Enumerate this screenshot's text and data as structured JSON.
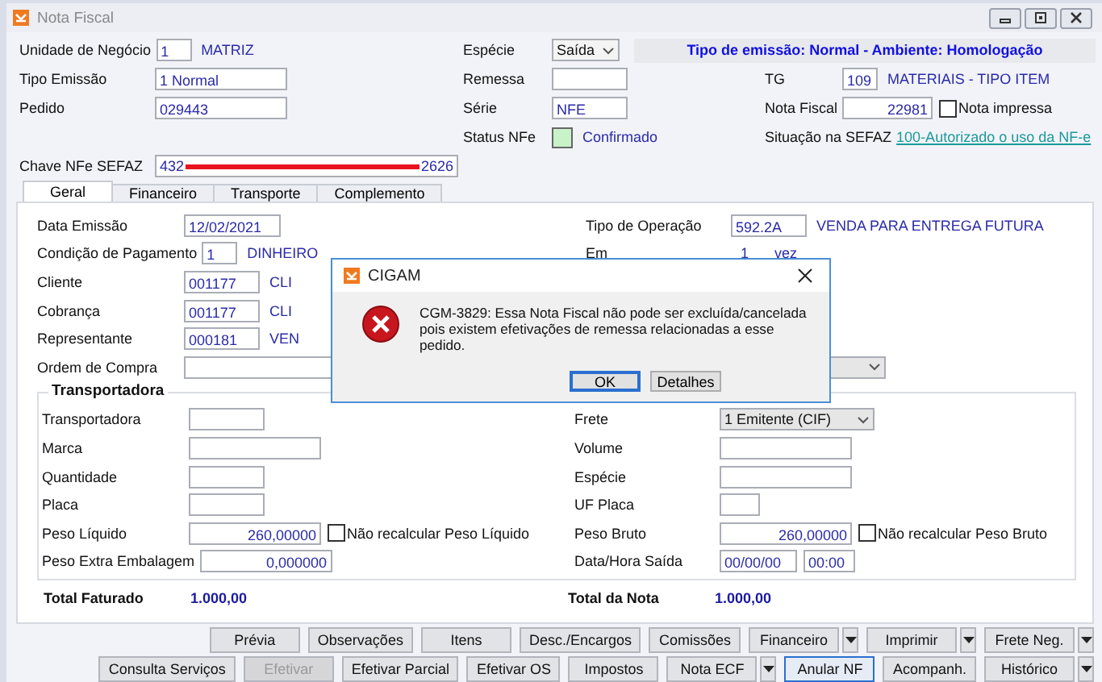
{
  "window": {
    "title": "Nota Fiscal"
  },
  "header": {
    "rows": [
      {
        "left": {
          "label": "Unidade de Negócio",
          "kind": "code",
          "value": "1",
          "description": "MATRIZ"
        },
        "middle": {
          "label": "Espécie",
          "kind": "select",
          "value": "Saída"
        },
        "banner": "Tipo de emissão: Normal - Ambiente: Homologação"
      },
      {
        "left": {
          "label": "Tipo Emissão",
          "kind": "text",
          "value": "1 Normal"
        },
        "middle": {
          "label": "Remessa",
          "kind": "short"
        },
        "right": {
          "label": "TG",
          "kind": "code",
          "value": "109",
          "description": "MATERIAIS - TIPO ITEM"
        }
      },
      {
        "left": {
          "label": "Pedido",
          "kind": "text",
          "value": "029443"
        },
        "middle": {
          "label": "Série",
          "kind": "short",
          "value": "NFE"
        },
        "right": {
          "label": "Nota Fiscal",
          "kind": "doc-number",
          "value": "22981",
          "checkbox": {
            "label": "Nota impressa",
            "checked": false
          }
        }
      },
      {
        "middle": {
          "label": "Status NFe",
          "kind": "status",
          "value": "Confirmado"
        },
        "right": {
          "label": "Situação na SEFAZ",
          "kind": "link",
          "value": "100-Autorizado o uso da NF-e"
        }
      },
      {
        "left": {
          "label": "Chave NFe SEFAZ",
          "kind": "redacted",
          "value_start": "432",
          "value_end": "2626"
        }
      }
    ]
  },
  "tabs": [
    {
      "label": "Geral",
      "selected": true
    },
    {
      "label": "Financeiro",
      "selected": false
    },
    {
      "label": "Transporte",
      "selected": false
    },
    {
      "label": "Complemento",
      "selected": false
    }
  ],
  "geral": {
    "rows": [
      {
        "left": {
          "label": "Data Emissão",
          "kind": "date",
          "value": "12/02/2021"
        },
        "right": {
          "label": "Tipo de Operação",
          "kind": "short",
          "value": "592.2A",
          "description": "VENDA PARA ENTREGA FUTURA"
        }
      },
      {
        "left": {
          "label": "Condição de Pagamento",
          "kind": "code",
          "value": "1",
          "description": "DINHEIRO"
        },
        "right": {
          "label": "Em",
          "kind": "plain",
          "value": "1",
          "unit": "vez"
        }
      },
      {
        "left": {
          "label": "Cliente",
          "kind": "short",
          "value": "001177",
          "description": "CLI"
        }
      },
      {
        "left": {
          "label": "Cobrança",
          "kind": "short",
          "value": "001177",
          "description": "CLI"
        }
      },
      {
        "left": {
          "label": "Representante",
          "kind": "short",
          "value": "000181",
          "description": "VEN"
        }
      },
      {
        "left": {
          "label": "Ordem de Compra",
          "kind": "wide"
        },
        "right": {
          "kind": "select"
        }
      }
    ]
  },
  "transportadora": {
    "title": "Transportadora",
    "rows": [
      {
        "left": {
          "label": "Transportadora",
          "kind": "short"
        },
        "right": {
          "label": "Frete",
          "kind": "select",
          "value": "1 Emitente (CIF)"
        }
      },
      {
        "left": {
          "label": "Marca",
          "kind": "text"
        },
        "right": {
          "label": "Volume",
          "kind": "text"
        }
      },
      {
        "left": {
          "label": "Quantidade",
          "kind": "short"
        },
        "right": {
          "label": "Espécie",
          "kind": "text"
        }
      },
      {
        "left": {
          "label": "Placa",
          "kind": "short"
        },
        "right": {
          "label": "UF Placa",
          "kind": "tiny"
        }
      },
      {
        "left": {
          "label": "Peso Líquido",
          "kind": "number",
          "value": "260,00000",
          "checkbox": {
            "label": "Não recalcular Peso Líquido",
            "checked": false
          }
        },
        "right": {
          "label": "Peso Bruto",
          "kind": "number",
          "value": "260,00000",
          "checkbox": {
            "label": "Não recalcular Peso Bruto",
            "checked": false
          }
        }
      },
      {
        "left": {
          "label": "Peso Extra Embalagem",
          "kind": "number",
          "value": "0,000000"
        },
        "right": {
          "label": "Data/Hora Saída",
          "kind": "datetime",
          "date": "00/00/00",
          "time": "00:00"
        }
      }
    ]
  },
  "totals": [
    {
      "label": "Total Faturado",
      "value": "1.000,00"
    },
    {
      "label": "Total da Nota",
      "value": "1.000,00"
    }
  ],
  "button_rows": [
    [
      {
        "label": "Prévia"
      },
      {
        "label": "Observações"
      },
      {
        "label": "Itens"
      },
      {
        "label": "Desc./Encargos"
      },
      {
        "label": "Comissões"
      },
      {
        "label": "Financeiro",
        "dropdown": true
      },
      {
        "label": "Imprimir",
        "dropdown": true
      },
      {
        "label": "Frete Neg.",
        "dropdown": true
      }
    ],
    [
      {
        "label": "Consulta Serviços"
      },
      {
        "label": "Efetivar",
        "disabled": true
      },
      {
        "label": "Efetivar Parcial"
      },
      {
        "label": "Efetivar OS"
      },
      {
        "label": "Impostos"
      },
      {
        "label": "Nota ECF",
        "dropdown": true
      },
      {
        "label": "Anular NF",
        "focused": true
      },
      {
        "label": "Acompanh."
      },
      {
        "label": "Histórico",
        "dropdown": true
      }
    ]
  ],
  "dialog": {
    "title": "CIGAM",
    "message": "CGM-3829: Essa Nota Fiscal não pode ser excluída/cancelada pois existem efetivações de remessa relacionadas a esse pedido.",
    "buttons": [
      {
        "label": "OK",
        "focused": true
      },
      {
        "label": "Detalhes",
        "focused": false
      }
    ]
  }
}
